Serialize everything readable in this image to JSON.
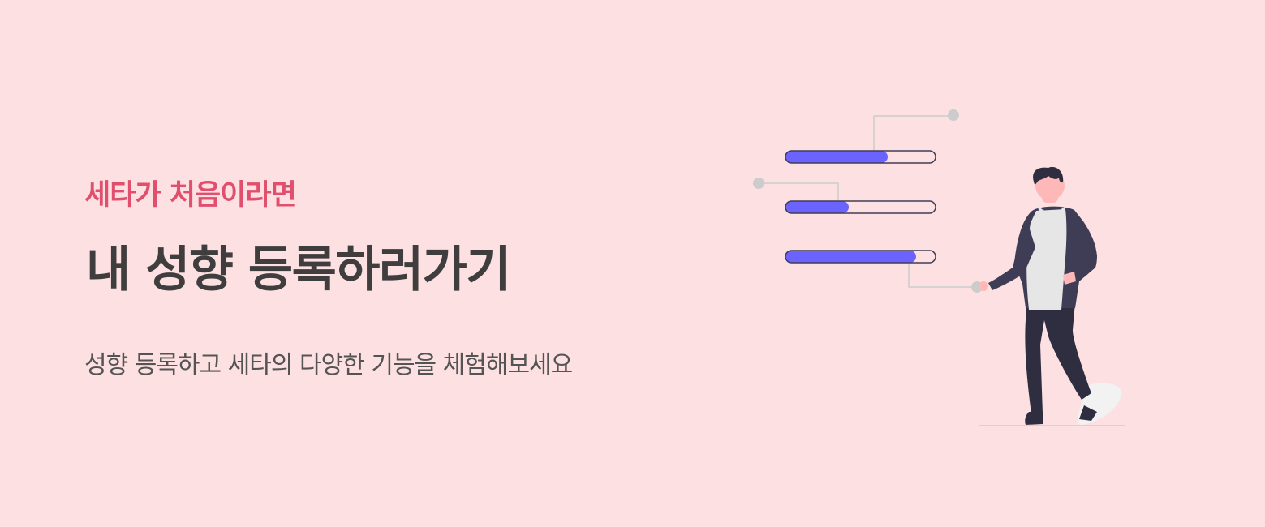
{
  "banner": {
    "eyebrow": "세타가 처음이라면",
    "headline": "내 성향 등록하러가기",
    "subtext": "성향 등록하고 세타의 다양한 기능을 체험해보세요"
  },
  "colors": {
    "background": "#fde0e1",
    "eyebrow": "#e0506e",
    "headline": "#3f3d3d",
    "subtext": "#555454",
    "bar_fill": "#6c63ff",
    "bar_outline": "#3f3d56",
    "connector": "#cccccc",
    "person_dark": "#2f2e41",
    "person_jacket": "#3f3d56",
    "person_skin": "#ffb8b8",
    "person_shirt": "#e6e6e6"
  },
  "illustration": {
    "icon": "person-with-progress-bars-illustration",
    "progress_bars": [
      {
        "fill": 0.68
      },
      {
        "fill": 0.42
      },
      {
        "fill": 0.87
      }
    ]
  }
}
